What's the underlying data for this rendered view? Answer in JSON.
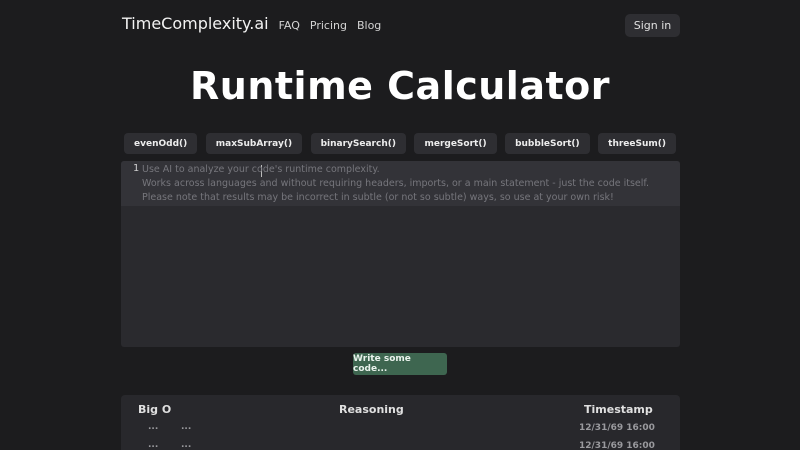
{
  "header": {
    "logo": "TimeComplexity.ai",
    "nav": [
      "FAQ",
      "Pricing",
      "Blog"
    ],
    "signin_label": "Sign in"
  },
  "main": {
    "title": "Runtime Calculator",
    "examples": [
      "evenOdd()",
      "maxSubArray()",
      "binarySearch()",
      "mergeSort()",
      "bubbleSort()",
      "threeSum()"
    ],
    "editor": {
      "line_number": "1",
      "placeholder_lines": [
        "Use AI to analyze your code's runtime complexity.",
        "Works across languages and without requiring headers, imports, or a main statement - just the code itself.",
        "Please note that results may be incorrect in subtle (or not so subtle) ways, so use at your own risk!"
      ]
    },
    "submit_label": "Write some code..."
  },
  "results": {
    "columns": [
      "Big O",
      "Reasoning",
      "Timestamp"
    ],
    "rows": [
      {
        "big_o": "...",
        "reasoning": "...",
        "timestamp": "12/31/69 16:00"
      },
      {
        "big_o": "...",
        "reasoning": "...",
        "timestamp": "12/31/69 16:00"
      }
    ]
  }
}
